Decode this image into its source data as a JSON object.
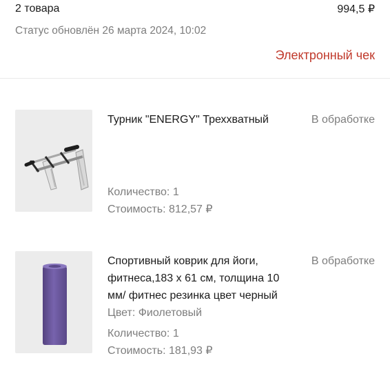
{
  "order": {
    "items_count": "2 товара",
    "total": "994,5 ₽",
    "status_updated": "Статус обновлён 26 марта 2024, 10:02",
    "receipt_link": "Электронный чек"
  },
  "products": [
    {
      "title": "Турник \"ENERGY\" Треххватный",
      "status": "В обработке",
      "quantity": "Количество: 1",
      "price": "Стоимость: 812,57 ₽",
      "image_icon": "pull-up-bar-image"
    },
    {
      "title": "Спортивный коврик для йоги, фитнеса,183 х 61 см, толщина 10 мм/ фитнес резинка цвет черный",
      "status": "В обработке",
      "color": "Цвет: Фиолетовый",
      "quantity": "Количество: 1",
      "price": "Стоимость: 181,93 ₽",
      "image_icon": "yoga-mat-image"
    }
  ],
  "colors": {
    "accent": "#c0392b",
    "secondary_text": "#7d7d7d",
    "thumb_bg": "#ececec",
    "mat_purple": "#6f5aa0"
  }
}
